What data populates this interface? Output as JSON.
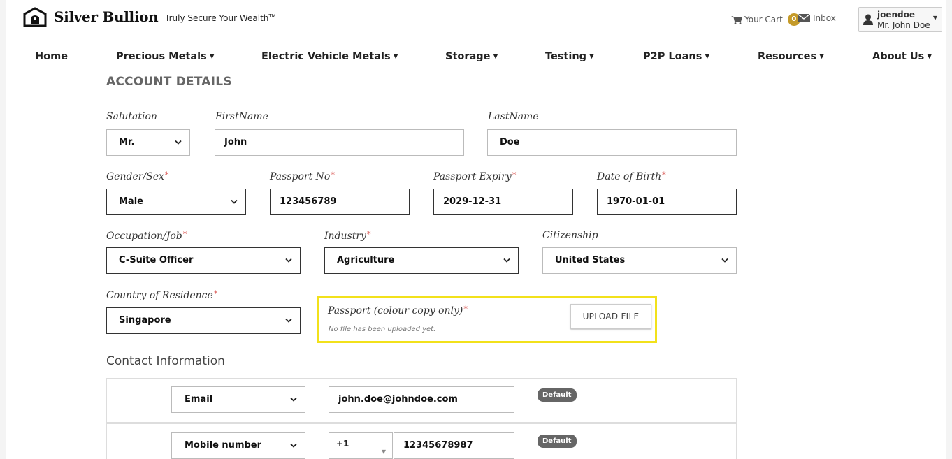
{
  "header": {
    "brand": "Silver Bullion",
    "tagline": "Truly Secure Your Wealth",
    "tagline_mark": "TM",
    "cart_label": "Your Cart",
    "cart_count": "0",
    "inbox_label": "Inbox",
    "username": "joendoe",
    "user_fullname": "Mr. John Doe"
  },
  "nav": {
    "items": [
      {
        "label": "Home"
      },
      {
        "label": "Precious Metals"
      },
      {
        "label": "Electric Vehicle Metals"
      },
      {
        "label": "Storage"
      },
      {
        "label": "Testing"
      },
      {
        "label": "P2P Loans"
      },
      {
        "label": "Resources"
      },
      {
        "label": "About Us"
      }
    ]
  },
  "form": {
    "section_title": "ACCOUNT DETAILS",
    "salutation": {
      "label": "Salutation",
      "value": "Mr."
    },
    "first_name": {
      "label": "FirstName",
      "value": "John"
    },
    "last_name": {
      "label": "LastName",
      "value": "Doe"
    },
    "gender": {
      "label": "Gender/Sex",
      "value": "Male"
    },
    "passport_no": {
      "label": "Passport No",
      "value": "123456789"
    },
    "passport_expiry": {
      "label": "Passport Expiry",
      "value": "2029-12-31"
    },
    "dob": {
      "label": "Date of Birth",
      "value": "1970-01-01"
    },
    "occupation": {
      "label": "Occupation/Job",
      "value": "C-Suite Officer"
    },
    "industry": {
      "label": "Industry",
      "value": "Agriculture"
    },
    "citizenship": {
      "label": "Citizenship",
      "value": "United States"
    },
    "residence": {
      "label": "Country of Residence",
      "value": "Singapore"
    },
    "required_mark": "*",
    "passport_upload": {
      "label": "Passport (colour copy only)",
      "note": "No file has been uploaded yet.",
      "button": "UPLOAD FILE",
      "highlight_color": "#f2e11b"
    }
  },
  "contact": {
    "title": "Contact Information",
    "rows": [
      {
        "type": "Email",
        "value": "john.doe@johndoe.com",
        "badge": "Default"
      },
      {
        "type": "Mobile number",
        "code": "+1",
        "value": "12345678987",
        "badge": "Default"
      }
    ]
  },
  "colors": {
    "accent_gold": "#c59b2a",
    "required_red": "#d9534f",
    "badge_gray": "#666666"
  }
}
